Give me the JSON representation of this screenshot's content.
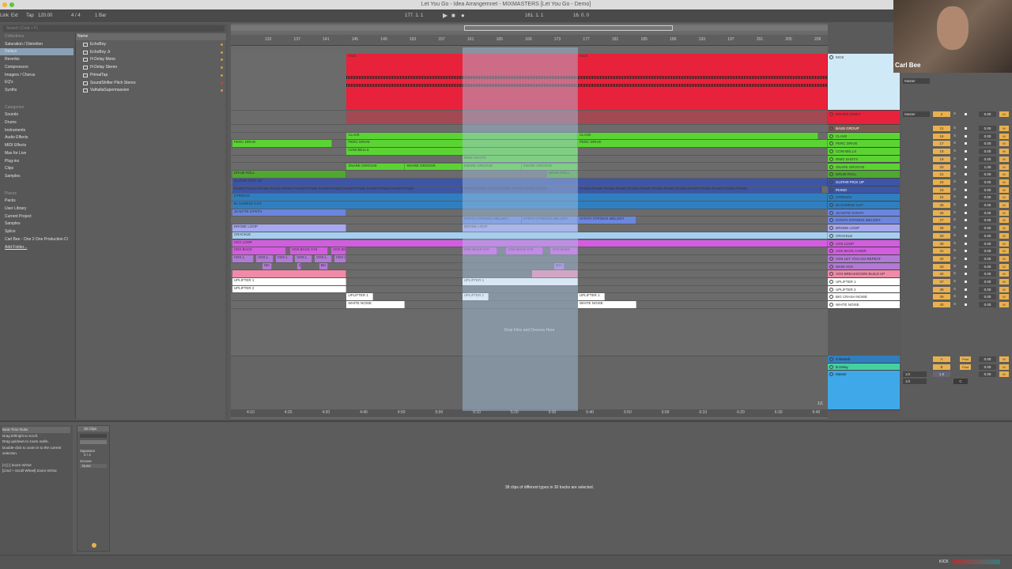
{
  "window": {
    "title": "Let You Go - Idea Arrangemnet - MIXMASTERS  [Let You Go - Demo]"
  },
  "control_bar": {
    "link": "Link",
    "ext": "Ext",
    "tap": "Tap",
    "tempo": "120.00",
    "signature": "4 / 4",
    "quantize": "1 Bar",
    "position": "177. 1. 1",
    "loop_start": "161. 1. 1",
    "loop_length": "16. 0. 0"
  },
  "browser": {
    "search_placeholder": "Search (Cmd + F)",
    "collections_heading": "Collections",
    "collections": [
      "Saturation / Distortion",
      "Delays",
      "Reverbs",
      "Compressors",
      "Imagers / Chorus",
      "EQ's",
      "Synths"
    ],
    "selected_collection": "Delays",
    "categories_heading": "Categories",
    "categories": [
      "Sounds",
      "Drums",
      "Instruments",
      "Audio Effects",
      "MIDI Effects",
      "Max for Live",
      "Plug-ins",
      "Clips",
      "Samples"
    ],
    "places_heading": "Places",
    "places": [
      "Packs",
      "User Library",
      "Current Project",
      "Samples",
      "Splice",
      "Carl Bee - One 2 One Production Cl",
      "Add Folder..."
    ],
    "name_header": "Name",
    "items": [
      "EchoBoy",
      "EchoBoy Jr",
      "H-Delay Mono",
      "H-Delay Stereo",
      "PrimalTap",
      "SoundShifter Pitch Stereo",
      "ValhallaSupermassive"
    ]
  },
  "ruler": {
    "bars": [
      133,
      137,
      141,
      145,
      149,
      153,
      157,
      161,
      165,
      169,
      173,
      177,
      181,
      185,
      189,
      193,
      197,
      201,
      205,
      209
    ],
    "times": [
      "4:10",
      "4:20",
      "4:30",
      "4:40",
      "4:50",
      "5:00",
      "5:10",
      "5:20",
      "5:30",
      "5:40",
      "5:50",
      "6:00",
      "6:10",
      "6:20",
      "6:30",
      "6:40"
    ],
    "page": "1/1"
  },
  "tracks": [
    {
      "name": "KICK",
      "color": "#e8223a",
      "hcolor": "#cfe9f7",
      "num": "",
      "vol": "",
      "clips": [
        [
          144.3,
          176.3,
          "KICK"
        ],
        [
          176.3,
          210.9,
          "KICK"
        ]
      ]
    },
    {
      "name": "DRUMS ENDLT",
      "color": "#e8223a",
      "num": "2",
      "vol": "0.00",
      "clips": [
        [
          144.3,
          176.3,
          ""
        ],
        [
          176.3,
          210.9,
          ""
        ]
      ]
    },
    {
      "name": "BASS GROUP",
      "color": "#7a5a50",
      "num": "11",
      "vol": "0.00",
      "clips": []
    },
    {
      "name": "CLAVE",
      "color": "#5bd433",
      "num": "16",
      "vol": "0.00",
      "clips": [
        [
          144.3,
          176.3,
          "CLAVE"
        ],
        [
          176.3,
          209.5,
          "CLAVE"
        ]
      ]
    },
    {
      "name": "PERC DRIVE",
      "color": "#5bd433",
      "num": "17",
      "vol": "0.00",
      "clips": [
        [
          128.5,
          142.3,
          "PERC DRIVE"
        ],
        [
          144.3,
          176.3,
          "PERC DRIVE"
        ],
        [
          176.3,
          210.9,
          "PERC DRIVE"
        ]
      ]
    },
    {
      "name": "COW BELLS",
      "color": "#5bd433",
      "num": "18",
      "vol": "0.00",
      "clips": [
        [
          144.3,
          176.3,
          "COW BELLS"
        ]
      ]
    },
    {
      "name": "RIMS SHOTS",
      "color": "#5bd433",
      "num": "19",
      "vol": "0.00",
      "clips": [
        [
          160.3,
          176.3,
          "RIMS SHOTS"
        ]
      ]
    },
    {
      "name": "SNARE GROOVE",
      "color": "#5bd433",
      "num": "20",
      "vol": "1.00",
      "clips": [
        [
          144.3,
          152.4,
          "SNARE GROOVE"
        ],
        [
          152.4,
          160.3,
          "SNARE GROOVE"
        ],
        [
          160.3,
          168.5,
          "SNARE GROOVE"
        ],
        [
          168.5,
          176.3,
          "SNARE GROOVE"
        ]
      ]
    },
    {
      "name": "DRUM ROLL",
      "color": "#4fa830",
      "num": "21",
      "vol": "0.00",
      "clips": [
        [
          128.5,
          144.3,
          "DRUM ROLL"
        ],
        [
          172,
          176.3,
          "DRUM ROLL"
        ]
      ]
    },
    {
      "name": "GUITAR PICK UP",
      "color": "#3c55a8",
      "num": "22",
      "vol": "0.00",
      "clips": [
        [
          128.5,
          210.9,
          "GUITAR PICK UP"
        ]
      ]
    },
    {
      "name": "PIANO",
      "color": "#3c55a8",
      "num": "23",
      "vol": "0.00",
      "clips": [
        [
          128.5,
          160.3,
          "PIANO PIANO PIANO PIANO PIANO PIANO PIANO PIANO PIANO PIANO PIANO PIANO PIANO PIANO PIANO"
        ],
        [
          160.3,
          176.3,
          "PIANO PIANO PIANO PIANO PIANO PIANO PIANO"
        ],
        [
          176.3,
          210,
          "PIANO PIANO PIANO PIANO PIANO PIANO PIANO PIANO PIANO PIANO PIANO PIANO PIANO PIANO"
        ]
      ]
    },
    {
      "name": "STRINGS",
      "color": "#2f7fc0",
      "num": "24",
      "vol": "0.00",
      "clips": [
        [
          128.5,
          210.9,
          "STRINGS"
        ]
      ]
    },
    {
      "name": "8s SAMPLE CUT",
      "color": "#2f7fc0",
      "num": "25",
      "vol": "0.00",
      "clips": [
        [
          128.5,
          210.9,
          "8s SAMPLE CUT"
        ]
      ]
    },
    {
      "name": "16 NOTE SYNTH",
      "color": "#6b86dd",
      "num": "26",
      "vol": "0.00",
      "clips": [
        [
          128.5,
          144.3,
          "16 NOTE SYNTH"
        ]
      ]
    },
    {
      "name": "SYNTH STRINGS MELODY",
      "color": "#6b86dd",
      "num": "27",
      "vol": "0.00",
      "clips": [
        [
          160.3,
          168.5,
          "SYNTH STRINGS MELODY"
        ],
        [
          168.5,
          176.3,
          "SYNTH STRINGS MELODY"
        ],
        [
          176.3,
          184.4,
          "SYNTH STRINGS MELODY"
        ]
      ]
    },
    {
      "name": "DRONE LOOP",
      "color": "#a7a8f0",
      "num": "28",
      "vol": "0.00",
      "clips": [
        [
          128.5,
          144.3,
          "DRONE LOOP"
        ],
        [
          160.3,
          176.3,
          "DRONE LOOP"
        ]
      ]
    },
    {
      "name": "CRACKLE",
      "color": "#a5cff2",
      "num": "29",
      "vol": "0.00",
      "clips": [
        [
          128.5,
          210.9,
          "CRACKLE"
        ]
      ]
    },
    {
      "name": "VOX LOOP",
      "color": "#d35ce0",
      "num": "30",
      "vol": "0.00",
      "clips": [
        [
          128.5,
          210.9,
          "VOX LOOP"
        ]
      ]
    },
    {
      "name": "VOX BACK CHOIR",
      "color": "#d35ce0",
      "num": "31",
      "vol": "0.00",
      "clips": [
        [
          128.5,
          136,
          "VOX BACK"
        ],
        [
          136.5,
          141.8,
          "VOX BACK CHI"
        ],
        [
          142.2,
          144.3,
          "VOX BACK"
        ],
        [
          160.3,
          165.2,
          "VOX BACK CHI"
        ],
        [
          166.4,
          171.5,
          "VOX BACK CHI"
        ],
        [
          172.5,
          176.3,
          "VOX BACK"
        ]
      ]
    },
    {
      "name": "VOX LET YOU GO REPEAT",
      "color": "#b17ad4",
      "num": "32",
      "vol": "0.00",
      "clips": [
        [
          128.5,
          131.5,
          "VOX L"
        ],
        [
          131.8,
          134.2,
          "VOX L"
        ],
        [
          134.5,
          136.9,
          "VOX L"
        ],
        [
          137.2,
          139.6,
          "VOX L"
        ],
        [
          139.9,
          142.3,
          "VOX L"
        ],
        [
          142.6,
          144.3,
          "VOX L"
        ]
      ]
    },
    {
      "name": "MAIN VOX",
      "color": "#b17ad4",
      "num": "33",
      "vol": "0.00",
      "clips": [
        [
          132.7,
          134,
          "MA"
        ],
        [
          137.5,
          138,
          "M"
        ],
        [
          140.5,
          141.7,
          "MA"
        ],
        [
          173,
          174.5,
          "MAI"
        ]
      ]
    },
    {
      "name": "VOX BREAKDOWN BUILD UP",
      "color": "#f08aa8",
      "num": "34",
      "vol": "0.00",
      "clips": [
        [
          128.5,
          144.3,
          ""
        ],
        [
          170,
          176.3,
          ""
        ]
      ]
    },
    {
      "name": "UPLIFTER 1",
      "color": "#ffffff",
      "num": "37",
      "vol": "0.00",
      "clips": [
        [
          128.5,
          144.3,
          "UPLIFTER 1"
        ],
        [
          160.3,
          176.3,
          "UPLIFTER 1"
        ]
      ]
    },
    {
      "name": "UPLIFTER 2",
      "color": "#ffffff",
      "num": "38",
      "vol": "0.00",
      "clips": [
        [
          128.5,
          144.3,
          "UPLIFTER 2"
        ]
      ]
    },
    {
      "name": "BIG CRASH NOISE",
      "color": "#ffffff",
      "num": "39",
      "vol": "0.00",
      "clips": [
        [
          144.3,
          148,
          "UPLIFTER 1"
        ],
        [
          160.3,
          164,
          "UPLIFTER 1"
        ],
        [
          176.3,
          180,
          "UPLIFTER 1"
        ]
      ]
    },
    {
      "name": "WHITE NOISE",
      "color": "#ffffff",
      "num": "40",
      "vol": "0.00",
      "clips": [
        [
          144.3,
          152.4,
          "WHITE NOISE"
        ],
        [
          176.3,
          184.4,
          "WHITE NOISE"
        ]
      ]
    }
  ],
  "mixer": {
    "master_out": "Master",
    "solo": "S",
    "monitor": "M",
    "pan": "C",
    "pan_value": "0"
  },
  "returns": [
    {
      "name": "A Reverb",
      "color": "#2f7fc0",
      "send": "A",
      "post": "Post",
      "vol": "0.00"
    },
    {
      "name": "B Delay",
      "color": "#45d0a0",
      "send": "B",
      "post": "Post",
      "vol": "0.00"
    },
    {
      "name": "Master",
      "color": "#3ea8e8",
      "send": "1.6",
      "post": "",
      "vol": "0.00",
      "cue": "1/2",
      "out": "1/2"
    }
  ],
  "arrangement": {
    "drop_hint": "Drop Files and Devices Here"
  },
  "webcam": {
    "name": "Carl Bee"
  },
  "info": {
    "title": "Beat-Time Ruler",
    "lines": [
      "Drag left/right to scroll.",
      "Drag up/down to zoom out/in.",
      "Double-click to zoom in to the current selection.",
      "",
      "[+] [-] Zoom In/Out",
      "[Cmd + Scroll Wheel] Zoom In/Out"
    ]
  },
  "clip_panel": {
    "title": "38 Clips",
    "signature_label": "Signature",
    "sig_num": "4",
    "sig_den": "4",
    "groove_label": "Groove",
    "groove_value": "None"
  },
  "detail": {
    "message": "38 clips of different types in 30 tracks are selected."
  },
  "status": {
    "track": "KICK"
  }
}
